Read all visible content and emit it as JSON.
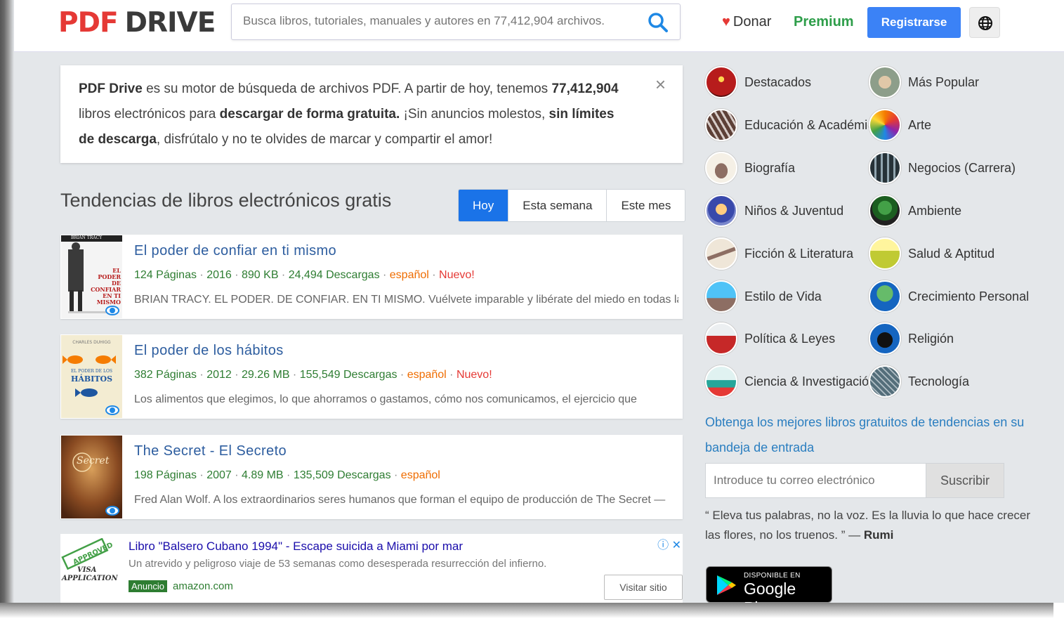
{
  "header": {
    "logo_part1": "PDF",
    "logo_part2": "DRIVE",
    "search_placeholder": "Busca libros, tutoriales, manuales y autores en 77,412,904 archivos.",
    "donate_label": "Donar",
    "premium_label": "Premium",
    "register_label": "Registrarse"
  },
  "intro": {
    "brand": "PDF Drive",
    "t1": " es su motor de búsqueda de archivos PDF. A partir de hoy, tenemos ",
    "count": "77,412,904",
    "t2": " libros electrónicos para ",
    "free": "descargar de forma gratuita.",
    "t3": " ¡Sin anuncios molestos, ",
    "nolimits": "sin límites de descarga",
    "t4": ", disfrútalo y no te olvides de marcar y compartir el amor!",
    "close": "×"
  },
  "trending": {
    "title": "Tendencias de libros electrónicos gratis",
    "tabs": [
      "Hoy",
      "Esta semana",
      "Este mes"
    ]
  },
  "books": [
    {
      "title": "El poder de confiar en ti mismo",
      "pages": "124 Páginas",
      "year": "2016",
      "size": "890 KB",
      "downloads": "24,494 Descargas",
      "lang": "español",
      "new": "Nuevo!",
      "desc": "BRIAN TRACY. EL PODER. DE CONFIAR. EN TI MISMO. Vuélvete imparable y libérate del miedo en todas las"
    },
    {
      "title": "El poder de los hábitos",
      "pages": "382 Páginas",
      "year": "2012",
      "size": "29.26 MB",
      "downloads": "155,549 Descargas",
      "lang": "español",
      "new": "Nuevo!",
      "desc": "Los alimentos que elegimos, lo que ahorramos o gastamos, cómo nos comunicamos, el ejercicio que"
    },
    {
      "title": "The Secret - El Secreto",
      "pages": "198 Páginas",
      "year": "2007",
      "size": "4.89 MB",
      "downloads": "135,509 Descargas",
      "lang": "español",
      "new": "",
      "desc": "Fred Alan Wolf. A los extraordinarios seres humanos que forman el equipo de producción de The Secret —"
    }
  ],
  "covers": {
    "b1_author": "BRIAN TRACY",
    "b1_title": "EL PODER DE CONFIAR EN TI MISMO",
    "b2_author": "CHARLES DUHIGG",
    "b2_title1": "EL PODER DE LOS",
    "b2_title2": "HÁBITOS",
    "b3_title": "Secret"
  },
  "ad": {
    "title": "Libro \"Balsero Cubano 1994\" - Escape suicida a Miami por mar",
    "text": "Un atrevido y peligroso viaje de 53 semanas como desesperada resurrección del infierno.",
    "badge": "Anuncio",
    "domain": "amazon.com",
    "visit": "Visitar sitio",
    "stamp1": "APPROVED",
    "stamp2": "VISA",
    "stamp3": "APPLICATION"
  },
  "categories": [
    {
      "label": "Destacados",
      "color": "#b71c1c",
      "icon": "theater-icon"
    },
    {
      "label": "Más Popular",
      "color": "#8d9e8a",
      "icon": "hands-icon"
    },
    {
      "label": "Educación & Académica",
      "color": "#5d4037",
      "icon": "pencils-icon"
    },
    {
      "label": "Arte",
      "color": "#f57c00",
      "icon": "paint-icon"
    },
    {
      "label": "Biografía",
      "color": "#a1887f",
      "icon": "book-icon"
    },
    {
      "label": "Negocios (Carrera)",
      "color": "#37474f",
      "icon": "people-icon"
    },
    {
      "label": "Niños & Juventud",
      "color": "#3949ab",
      "icon": "child-icon"
    },
    {
      "label": "Ambiente",
      "color": "#2e7d32",
      "icon": "tree-icon"
    },
    {
      "label": "Ficción & Literatura",
      "color": "#8d6e63",
      "icon": "open-book-icon"
    },
    {
      "label": "Salud & Aptitud",
      "color": "#c0ca33",
      "icon": "field-icon"
    },
    {
      "label": "Estilo de Vida",
      "color": "#4fc3f7",
      "icon": "family-icon"
    },
    {
      "label": "Crecimiento Personal",
      "color": "#43a047",
      "icon": "growth-tree-icon"
    },
    {
      "label": "Política & Leyes",
      "color": "#c62828",
      "icon": "crowd-icon"
    },
    {
      "label": "Religión",
      "color": "#1565c0",
      "icon": "praying-hands-icon"
    },
    {
      "label": "Ciencia & Investigación",
      "color": "#26a69a",
      "icon": "lab-icon"
    },
    {
      "label": "Tecnología",
      "color": "#546e7a",
      "icon": "circuit-icon"
    }
  ],
  "sidebar": {
    "newsletter": "Obtenga los mejores libros gratuitos de tendencias en su bandeja de entrada",
    "email_placeholder": "Introduce tu correo electrónico",
    "subscribe": "Suscribir",
    "quote": "“ Eleva tus palabras, no la voz. Es la lluvia lo que hace crecer las flores, no los truenos. ” —",
    "quote_author": "Rumi",
    "gplay_small": "DISPONIBLE EN",
    "gplay_big": "Google Play"
  }
}
